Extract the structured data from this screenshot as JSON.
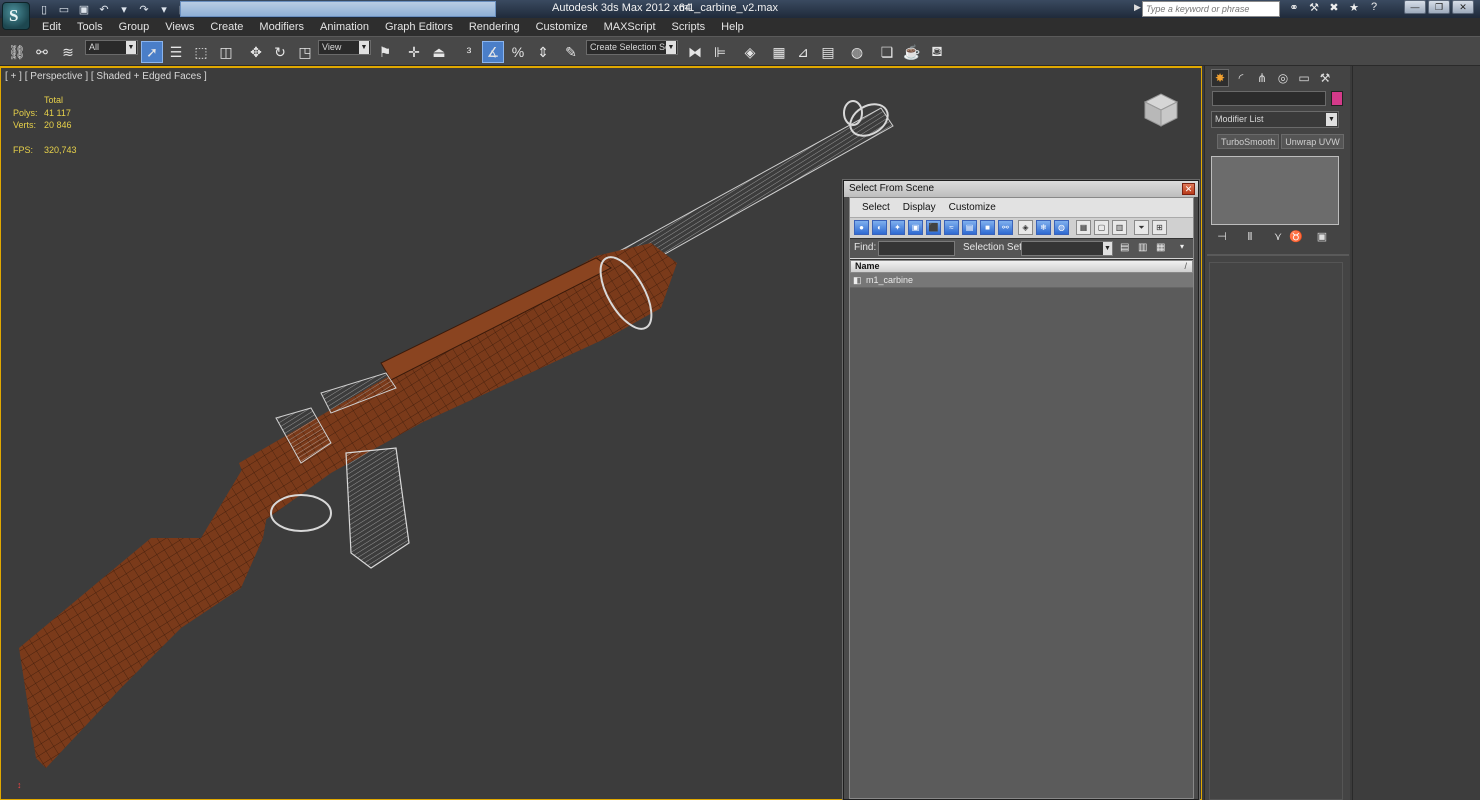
{
  "titlebar": {
    "app_title": "Autodesk 3ds Max  2012 x64",
    "file_title": "m1_carbine_v2.max",
    "search_placeholder": "Type a keyword or phrase",
    "logo_letter": "S"
  },
  "menu": {
    "items": [
      "Edit",
      "Tools",
      "Group",
      "Views",
      "Create",
      "Modifiers",
      "Animation",
      "Graph Editors",
      "Rendering",
      "Customize",
      "MAXScript",
      "Scripts",
      "Help"
    ]
  },
  "toolbar": {
    "selection_filter": "All",
    "reference_coord": "View",
    "named_selection": "Create Selection Se"
  },
  "viewport": {
    "label": "[ + ] [ Perspective ] [ Shaded + Edged Faces ]",
    "stats": {
      "total_label": "Total",
      "polys_label": "Polys:",
      "polys_value": "41 117",
      "verts_label": "Verts:",
      "verts_value": "20 846",
      "fps_label": "FPS:",
      "fps_value": "320,743"
    }
  },
  "dialog": {
    "title": "Select From Scene",
    "menu": [
      "Select",
      "Display",
      "Customize"
    ],
    "find_label": "Find:",
    "selset_label": "Selection Set:",
    "column_name": "Name",
    "objects": [
      "m1_carbine"
    ]
  },
  "command_panel": {
    "modifier_list": "Modifier List",
    "buttons": [
      "TurboSmooth",
      "Unwrap UVW"
    ],
    "object_color": "#d43a8a"
  }
}
